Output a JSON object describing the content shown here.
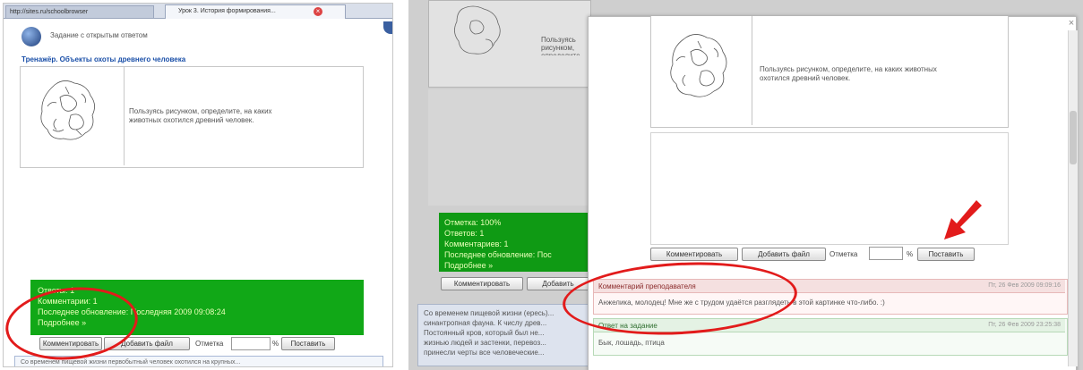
{
  "left": {
    "tabs": [
      "http://sites.ru/schoolbrowser",
      "Урок 3. История формирования..."
    ],
    "window_title": "Задание с открытым ответом",
    "task_link": "Тренажёр. Объекты охоты древнего человека",
    "question": "Пользуясь рисунком, определите, на каких животных охотился древний человек.",
    "status": [
      "Ответы: 1",
      "Комментарии: 1",
      "Последнее обновление: Последняя 2009 09:08:24",
      "Подробнее »"
    ],
    "buttons": {
      "comment": "Комментировать",
      "add_file": "Добавить файл",
      "grade_label": "Отметка",
      "percent": "%",
      "submit": "Поставить"
    },
    "bottom_text": "Со временем пищевой жизни первобытный человек охотился на крупных..."
  },
  "right": {
    "bg_question": "Пользуясь рисунком, определите...",
    "bg_status": [
      "Отметка: 100%",
      "Ответов: 1",
      "Комментариев: 1",
      "Последнее обновление: Пос",
      "Подробнее »"
    ],
    "bg_buttons": {
      "comment": "Комментировать",
      "add_file": "Добавить"
    },
    "bg_text": [
      "Со временем пищевой жизни (ересь)...",
      "синантропная фауна. К числу древ...",
      "Постоянный кров, который был не...",
      "жизнью людей и застенки, перевоз...",
      "принесли черты все человеческие..."
    ],
    "popup": {
      "question": "Пользуясь рисунком, определите, на каких животных охотился древний человек.",
      "buttons": {
        "comment": "Комментировать",
        "add_file": "Добавить файл",
        "grade_label": "Отметка",
        "percent": "%",
        "submit": "Поставить"
      },
      "teacher_comment": {
        "title": "Комментарий преподавателя",
        "date": "Пт, 26 Фев 2009 09:09:16",
        "text": "Анжелика, молодец! Мне же с трудом удаётся разглядеть в этой картинке что-либо. :)"
      },
      "answer": {
        "title": "Ответ на задание",
        "date": "Пт, 26 Фев 2009 23:25:38",
        "text": "Бык, лошадь, птица"
      }
    }
  },
  "colors": {
    "green": "#11a817",
    "red": "#e21b1b",
    "link": "#1a4fa8"
  }
}
